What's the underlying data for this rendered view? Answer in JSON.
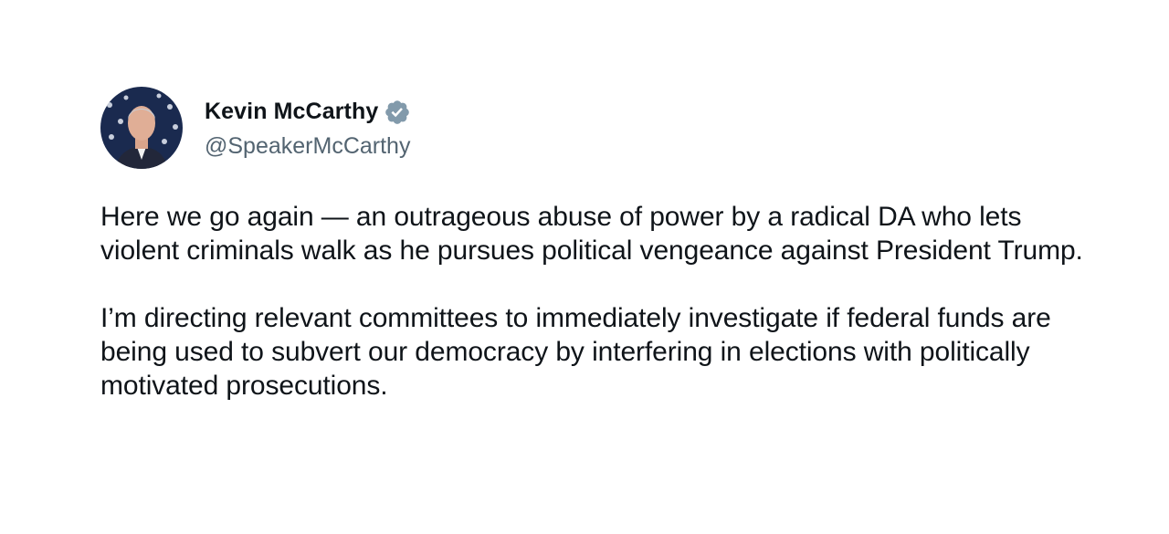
{
  "tweet": {
    "author": {
      "display_name": "Kevin McCarthy",
      "handle": "@SpeakerMcCarthy",
      "verified_icon": "verified-badge-icon",
      "badge_color": "#829aab"
    },
    "paragraphs": [
      "Here we go again — an outrageous abuse of power by a radical DA who lets violent criminals walk as he pursues political vengeance against President Trump.",
      "I’m directing relevant committees to immediately investigate if federal funds are being used to subvert our democracy by interfering in elections with politically motivated prosecutions."
    ]
  }
}
